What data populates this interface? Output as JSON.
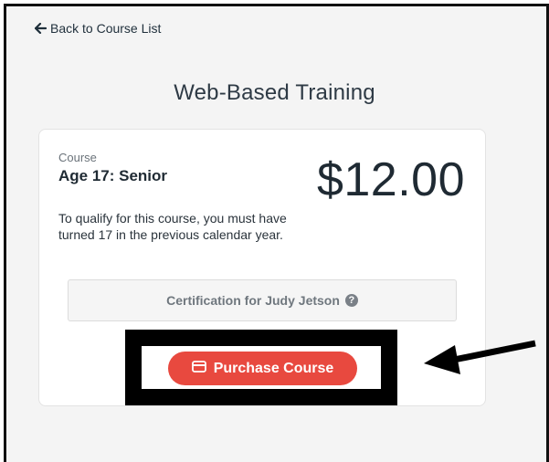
{
  "nav": {
    "back_label": "Back to Course List"
  },
  "page": {
    "title": "Web-Based Training"
  },
  "course": {
    "kicker": "Course",
    "name": "Age 17: Senior",
    "price": "$12.00",
    "description": "To qualify for this course, you must have turned 17 in the previous calendar year.",
    "certification_label": "Certification for Judy Jetson",
    "help_glyph": "?",
    "purchase_label": "Purchase Course"
  },
  "icons": {
    "back": "arrow-left-icon",
    "help": "question-circle-icon",
    "purchase": "credit-card-icon",
    "annotation": "pointer-arrow-icon"
  },
  "colors": {
    "accent": "#e8493f",
    "annotation": "#000000",
    "text_dark": "#1f2a33"
  }
}
